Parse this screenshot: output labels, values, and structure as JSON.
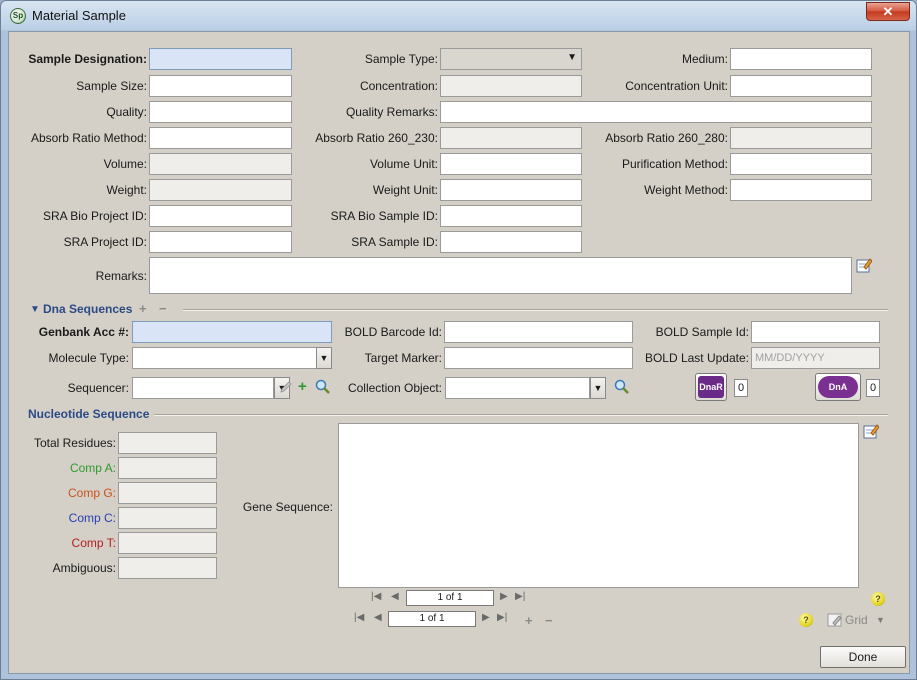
{
  "window": {
    "title": "Material Sample",
    "close_label": "✕"
  },
  "colors": {
    "focus": "#d9e5f6",
    "compA": "#2e9a2e",
    "compG": "#c8531c",
    "compC": "#2a3fb4",
    "compT": "#b41e1e",
    "section": "#2b4a86"
  },
  "sample": {
    "designation_label": "Sample Designation:",
    "type_label": "Sample Type:",
    "medium_label": "Medium:",
    "size_label": "Sample Size:",
    "concentration_label": "Concentration:",
    "concentration_unit_label": "Concentration Unit:",
    "quality_label": "Quality:",
    "quality_remarks_label": "Quality Remarks:",
    "absorb_method_label": "Absorb Ratio Method:",
    "absorb_230_label": "Absorb Ratio 260_230:",
    "absorb_280_label": "Absorb Ratio 260_280:",
    "volume_label": "Volume:",
    "volume_unit_label": "Volume Unit:",
    "purification_label": "Purification Method:",
    "weight_label": "Weight:",
    "weight_unit_label": "Weight Unit:",
    "weight_method_label": "Weight Method:",
    "sra_bio_project_label": "SRA Bio Project ID:",
    "sra_bio_sample_label": "SRA Bio Sample ID:",
    "sra_project_label": "SRA Project ID:",
    "sra_sample_label": "SRA Sample ID:",
    "remarks_label": "Remarks:"
  },
  "dna": {
    "header": "Dna Sequences",
    "genbank_label": "Genbank Acc #:",
    "bold_barcode_label": "BOLD Barcode Id:",
    "bold_sample_label": "BOLD Sample Id:",
    "molecule_label": "Molecule Type:",
    "target_marker_label": "Target Marker:",
    "bold_last_update_label": "BOLD Last Update:",
    "bold_last_update_placeholder": "MM/DD/YYYY",
    "sequencer_label": "Sequencer:",
    "collection_object_label": "Collection Object:",
    "dnar_label": "DnaR",
    "dnar_count": "0",
    "dna_label": "DnA",
    "dna_count": "0"
  },
  "nucleotide": {
    "header": "Nucleotide Sequence",
    "total_residues_label": "Total Residues:",
    "comp_a_label": "Comp A:",
    "comp_g_label": "Comp G:",
    "comp_c_label": "Comp C:",
    "comp_t_label": "Comp T:",
    "ambiguous_label": "Ambiguous:",
    "gene_sequence_label": "Gene Sequence:"
  },
  "pager_inner": {
    "text": "1 of 1"
  },
  "pager_outer": {
    "text": "1 of 1",
    "grid_label": "Grid"
  },
  "footer": {
    "done_label": "Done"
  }
}
